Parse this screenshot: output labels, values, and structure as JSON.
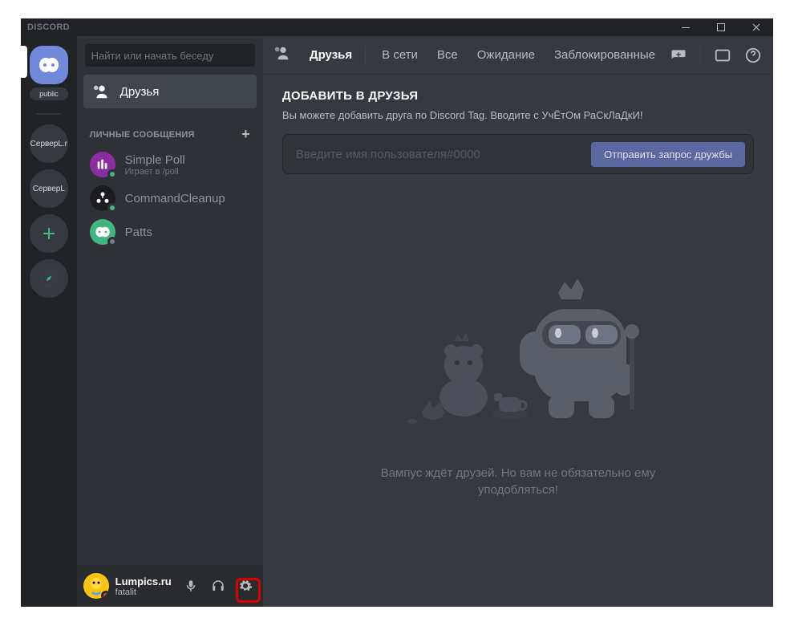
{
  "titlebar": {
    "brand": "DISCORD"
  },
  "guilds": {
    "home_folder_label": "public",
    "servers": [
      {
        "initials": "СерверL.r"
      },
      {
        "initials": "СерверL"
      }
    ]
  },
  "channels": {
    "search_placeholder": "Найти или начать беседу",
    "friends_label": "Друзья",
    "dm_header": "ЛИЧНЫЕ СООБЩЕНИЯ",
    "dms": [
      {
        "name": "Simple Poll",
        "sub": "Играет в /poll",
        "avatar_bg": "#882ea0",
        "status": "#43b581"
      },
      {
        "name": "CommandCleanup",
        "sub": "",
        "avatar_bg": "#1b1d20",
        "status": "#43b581"
      },
      {
        "name": "Patts",
        "sub": "",
        "avatar_bg": "#43b581",
        "status": "#747f8d"
      }
    ]
  },
  "user": {
    "name": "Lumpics.ru",
    "sub": "fatalit"
  },
  "topbar": {
    "friends_label": "Друзья",
    "tabs": [
      "В сети",
      "Все",
      "Ожидание",
      "Заблокированные"
    ]
  },
  "addfriend": {
    "title": "ДОБАВИТЬ В ДРУЗЬЯ",
    "sub": "Вы можете добавить друга по Discord Tag. Вводите с УчЁтОм РаСкЛаДкИ!",
    "placeholder": "Введите имя пользователя#0000",
    "send": "Отправить запрос дружбы"
  },
  "empty": {
    "text": "Вампус ждёт друзей. Но вам не обязательно ему уподобляться!"
  }
}
